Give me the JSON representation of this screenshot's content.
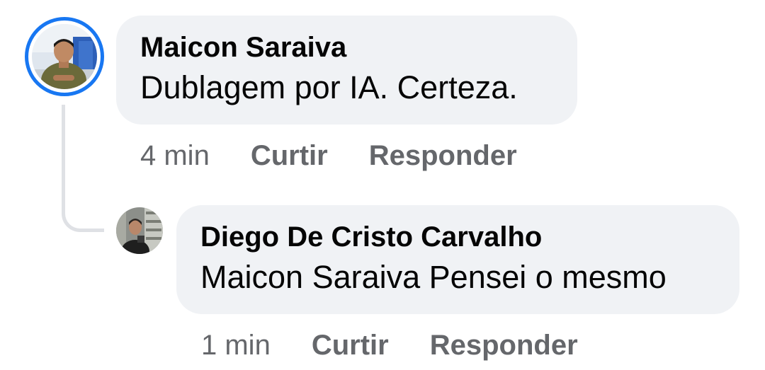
{
  "comments": [
    {
      "author": "Maicon Saraiva",
      "text": "Dublagem por IA. Certeza.",
      "time": "4 min",
      "like_label": "Curtir",
      "reply_label": "Responder",
      "avatar": "avatar-photo-man-green-shirt",
      "avatar_ring_color": "#1877f2"
    }
  ],
  "replies": [
    {
      "author": "Diego De Cristo Carvalho",
      "text": "Maicon Saraiva Pensei o mesmo",
      "time": "1 min",
      "like_label": "Curtir",
      "reply_label": "Responder",
      "avatar": "avatar-photo-man-shelves"
    }
  ],
  "colors": {
    "bubble_bg": "#f0f2f5",
    "author_text": "#050505",
    "meta_text": "#65676b",
    "thread_line": "#dfe1e5"
  }
}
